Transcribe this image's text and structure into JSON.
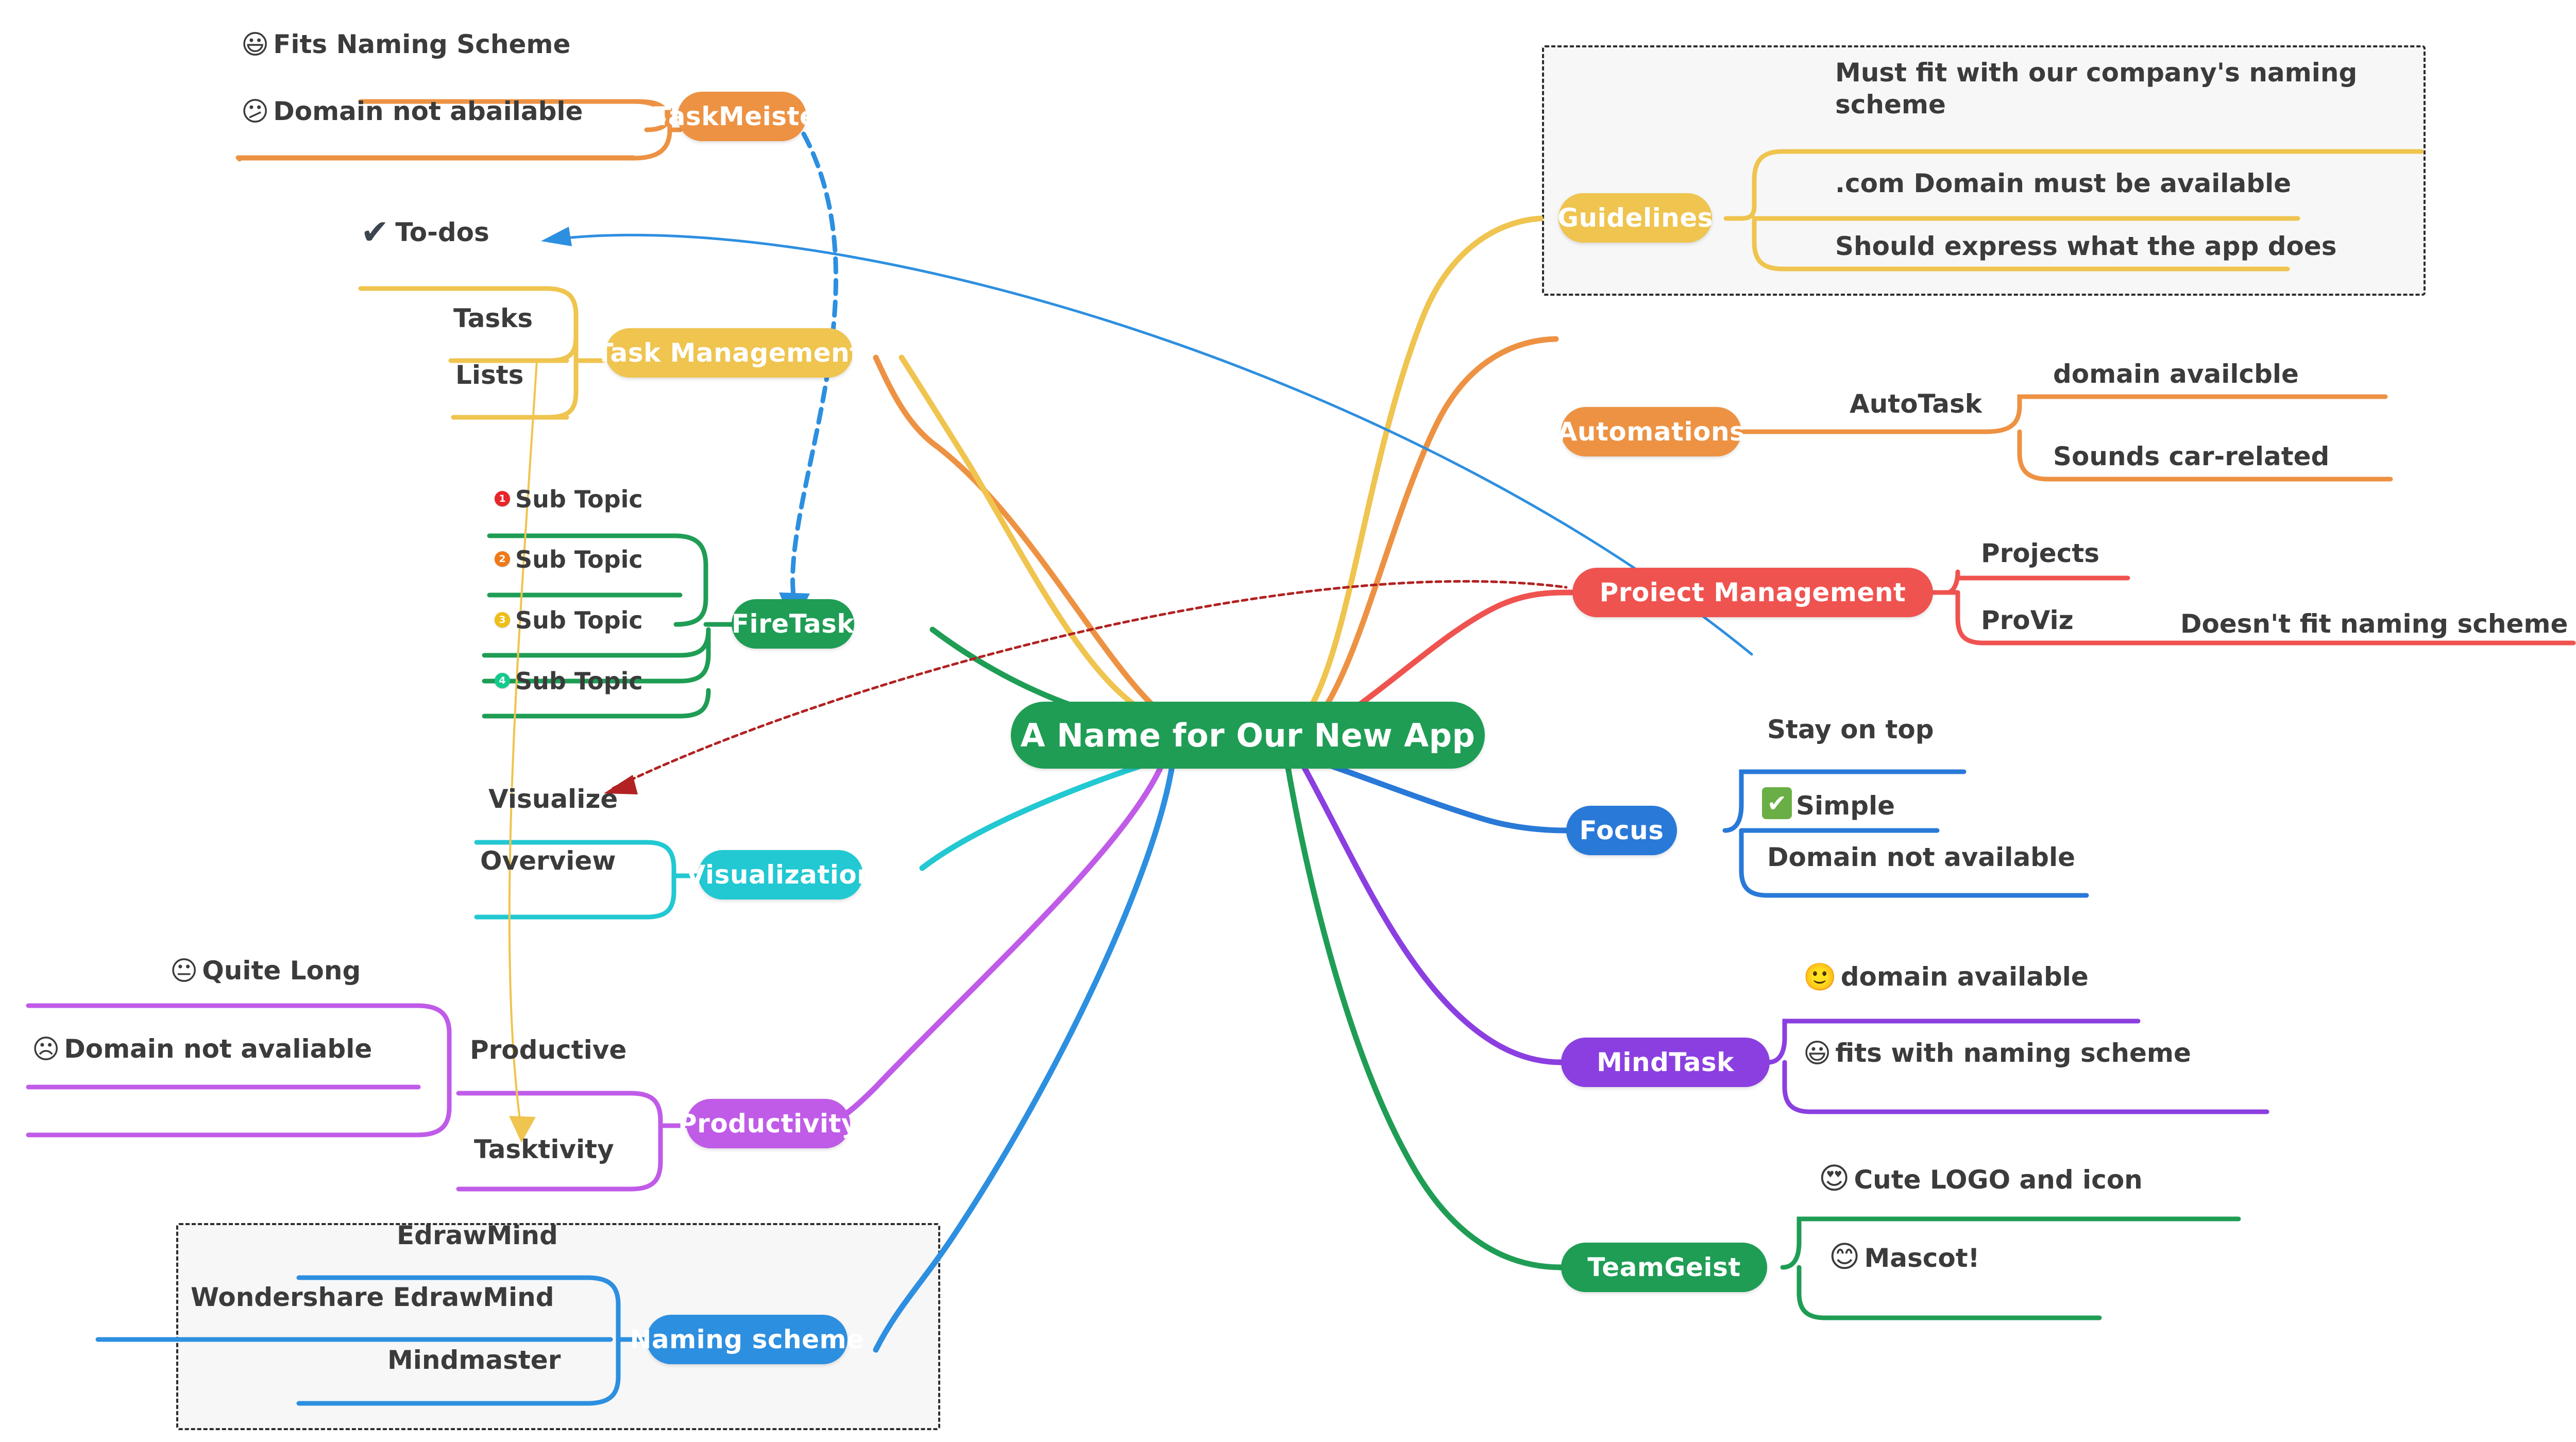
{
  "map": {
    "central": {
      "label": "A Name for Our New App",
      "color": "#1f9d55"
    },
    "colors": {
      "orange": "#ED9243",
      "yellow": "#EFC44F",
      "green": "#1f9d55",
      "teal": "#22C8D2",
      "purple_light": "#C05BE8",
      "blue": "#2D8FE0",
      "blue_dark": "#2979D8",
      "red": "#EF5350",
      "purple": "#8B3FE0",
      "text_dark": "#3b3b3b"
    },
    "branches": [
      {
        "id": "taskmeister",
        "label": "TaskMeister",
        "color": "#ED9243",
        "leaves": [
          {
            "text": "Fits Naming Scheme",
            "icon": "grinning-face-emoji",
            "glyph": "😃"
          },
          {
            "text": "Domain not abailable",
            "icon": "slightly-frowning-face-emoji",
            "glyph": "😕"
          }
        ]
      },
      {
        "id": "task-management",
        "label": "Task Management",
        "color": "#EFC44F",
        "leaves": [
          {
            "text": "To-dos",
            "icon": "check-mark-icon",
            "glyph": "✔"
          },
          {
            "text": "Tasks",
            "icon": null,
            "glyph": null
          },
          {
            "text": "Lists",
            "icon": null,
            "glyph": null
          }
        ]
      },
      {
        "id": "firetask",
        "label": "FireTask",
        "color": "#1f9d55",
        "leaves": [
          {
            "text": "Sub Topic",
            "icon": "number-badge-1",
            "glyph": "1",
            "badge_color": "#E8252A"
          },
          {
            "text": "Sub Topic",
            "icon": "number-badge-2",
            "glyph": "2",
            "badge_color": "#F07818"
          },
          {
            "text": "Sub Topic",
            "icon": "number-badge-3",
            "glyph": "3",
            "badge_color": "#F0BE18"
          },
          {
            "text": "Sub Topic",
            "icon": "number-badge-4",
            "glyph": "4",
            "badge_color": "#16C98D"
          }
        ]
      },
      {
        "id": "visualization",
        "label": "Visualization",
        "color": "#22C8D2",
        "leaves": [
          {
            "text": "Visualize",
            "icon": null,
            "glyph": null
          },
          {
            "text": "Overview",
            "icon": null,
            "glyph": null
          }
        ]
      },
      {
        "id": "productivity",
        "label": "Productivity",
        "color": "#C05BE8",
        "leaves": [
          {
            "text": "Productive",
            "icon": null,
            "glyph": null
          },
          {
            "text": "Tasktivity",
            "icon": null,
            "glyph": null
          }
        ],
        "sub_leaves": [
          {
            "text": "Quite Long",
            "icon": "neutral-face-emoji",
            "glyph": "😐"
          },
          {
            "text": "Domain not avaliable",
            "icon": "frowning-face-emoji",
            "glyph": "☹"
          }
        ]
      },
      {
        "id": "naming-scheme",
        "label": "Naming scheme",
        "color": "#2D8FE0",
        "leaves": [
          {
            "text": "EdrawMind",
            "icon": null,
            "glyph": null
          },
          {
            "text": "Wondershare EdrawMind",
            "icon": null,
            "glyph": null
          },
          {
            "text": "Mindmaster",
            "icon": null,
            "glyph": null
          }
        ]
      },
      {
        "id": "guidelines",
        "label": "Guidelines",
        "color": "#EFC44F",
        "leaves": [
          {
            "text": "Must fit with our company's naming scheme",
            "icon": null,
            "glyph": null
          },
          {
            "text": ".com Domain must be available",
            "icon": null,
            "glyph": null
          },
          {
            "text": "Should express what the app does",
            "icon": null,
            "glyph": null
          }
        ]
      },
      {
        "id": "automations",
        "label": "Automations",
        "color": "#ED9243",
        "mid_label": "AutoTask",
        "leaves": [
          {
            "text": "domain availcble",
            "icon": null,
            "glyph": null
          },
          {
            "text": "Sounds car-related",
            "icon": null,
            "glyph": null
          }
        ]
      },
      {
        "id": "project-management",
        "label": "Proiect Management",
        "color": "#EF5350",
        "leaves": [
          {
            "text": "Projects",
            "icon": null,
            "glyph": null
          },
          {
            "text": "ProViz",
            "icon": null,
            "glyph": null
          }
        ],
        "note": "Doesn't fit naming scheme"
      },
      {
        "id": "focus",
        "label": "Focus",
        "color": "#2979D8",
        "leaves": [
          {
            "text": "Stay on top",
            "icon": null,
            "glyph": null
          },
          {
            "text": "Simple",
            "icon": "green-check-box-icon",
            "glyph": "✔"
          },
          {
            "text": "Domain not available",
            "icon": null,
            "glyph": null
          }
        ]
      },
      {
        "id": "mindtask",
        "label": "MindTask",
        "color": "#8B3FE0",
        "leaves": [
          {
            "text": "domain available",
            "icon": "slightly-smiling-face-emoji",
            "glyph": "🙂"
          },
          {
            "text": "fits with naming scheme",
            "icon": "grinning-face-emoji",
            "glyph": "😃"
          }
        ]
      },
      {
        "id": "teamgeist",
        "label": "TeamGeist",
        "color": "#1f9d55",
        "leaves": [
          {
            "text": "Cute LOGO and icon",
            "icon": "smiling-face-with-hearts-emoji",
            "glyph": "😍"
          },
          {
            "text": "Mascot!",
            "icon": "smiling-face-with-smiling-eyes-emoji",
            "glyph": "😊"
          }
        ]
      }
    ]
  }
}
